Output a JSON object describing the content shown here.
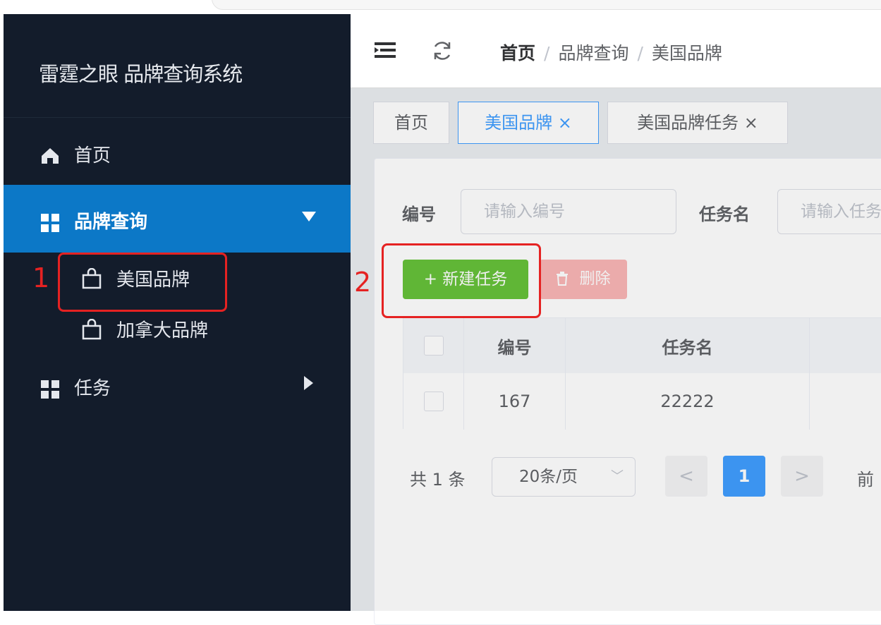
{
  "sidebar": {
    "title": "雷霆之眼 品牌查询系统",
    "items": [
      {
        "label": "首页",
        "icon": "home-icon"
      },
      {
        "label": "品牌查询",
        "icon": "grid-icon",
        "expanded": true,
        "children": [
          {
            "label": "美国品牌",
            "icon": "shopping-bag-icon",
            "active": true
          },
          {
            "label": "加拿大品牌",
            "icon": "shopping-bag-icon"
          }
        ]
      },
      {
        "label": "任务",
        "icon": "grid-icon",
        "expanded": false
      }
    ]
  },
  "annotations": {
    "step1": "1",
    "step2": "2",
    "color": "#e52222"
  },
  "header": {
    "breadcrumb": [
      "首页",
      "品牌查询",
      "美国品牌"
    ],
    "separator": "/"
  },
  "tabs": [
    {
      "label": "首页"
    },
    {
      "label": "美国品牌 ×",
      "active": true
    },
    {
      "label": "美国品牌任务 ×"
    }
  ],
  "filters": [
    {
      "label": "编号",
      "placeholder": "请输入编号"
    },
    {
      "label": "任务名",
      "placeholder": "请输入任务名"
    }
  ],
  "toolbar": {
    "new_label": "+ 新建任务",
    "delete_label": "删除",
    "delete_icon": "trash-icon"
  },
  "table": {
    "columns": [
      "编号",
      "任务名"
    ],
    "rows": [
      {
        "id": "167",
        "name": "22222"
      }
    ]
  },
  "pagination": {
    "total": "共 1 条",
    "page_size": "20条/页",
    "prev": "<",
    "current": "1",
    "next": ">",
    "goto": "前"
  },
  "colors": {
    "sidebar_bg": "#131c2b",
    "active_menu": "#0c78c7",
    "primary": "#409eff",
    "success": "#67c23a",
    "danger_disabled": "#fab6b6"
  }
}
